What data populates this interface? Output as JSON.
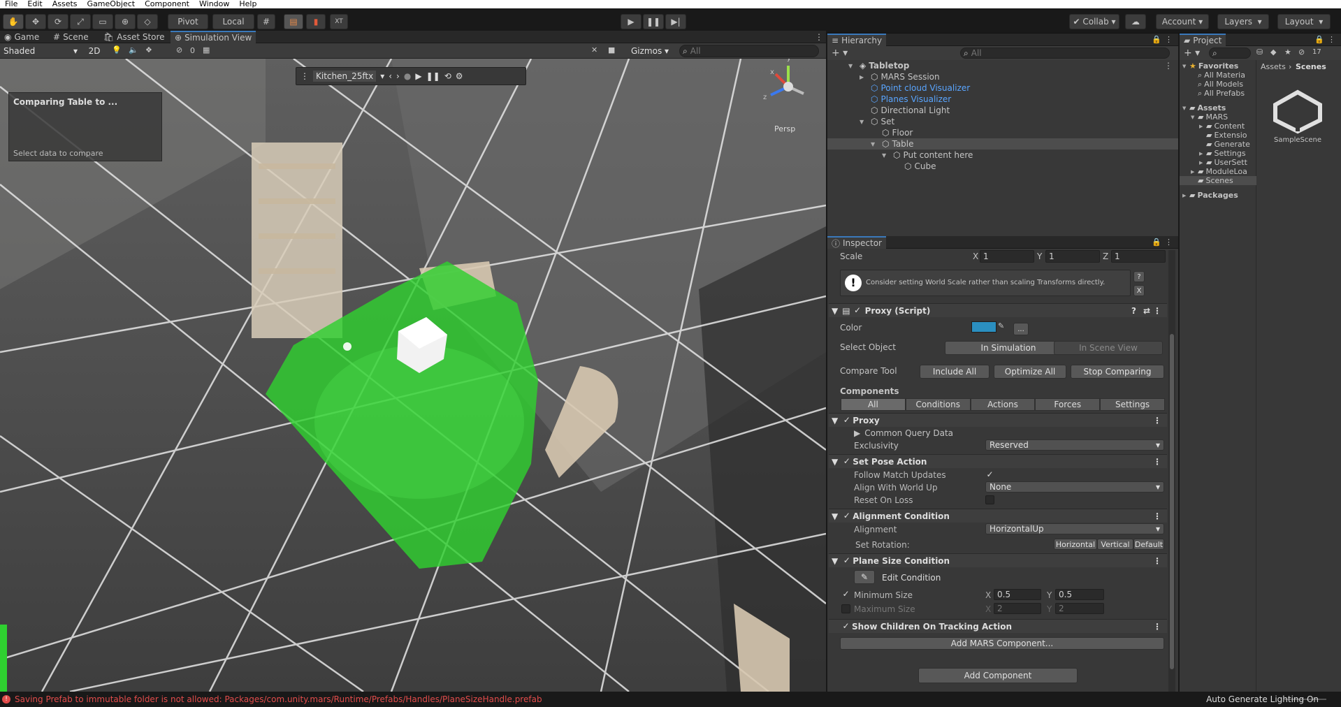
{
  "menu": [
    "File",
    "Edit",
    "Assets",
    "GameObject",
    "Component",
    "Window",
    "Help"
  ],
  "toolbar": {
    "pivot": "Pivot",
    "local": "Local",
    "collab": "Collab",
    "account": "Account",
    "layers": "Layers",
    "layout": "Layout"
  },
  "scene_tabs": {
    "game": "Game",
    "scene": "Scene",
    "store": "Asset Store",
    "sim": "Simulation View"
  },
  "scene_sub": {
    "shade": "Shaded",
    "twod": "2D",
    "hidden_count": "0",
    "gizmos": "Gizmos",
    "search_placeholder": "All"
  },
  "overlay": {
    "title": "Comparing Table to ...",
    "sub": "Select data to compare"
  },
  "simbar": {
    "env": "Kitchen_25ftx"
  },
  "gizmo": {
    "persp": "Persp",
    "x": "x",
    "y": "y",
    "z": "z"
  },
  "hierarchy": {
    "title": "Hierarchy",
    "search": "All",
    "items": [
      {
        "label": "Tabletop",
        "level": 0,
        "bold": true,
        "arrow": "▼"
      },
      {
        "label": "MARS Session",
        "level": 1,
        "arrow": "▶"
      },
      {
        "label": "Point cloud Visualizer",
        "level": 1,
        "blue": true
      },
      {
        "label": "Planes Visualizer",
        "level": 1,
        "blue": true
      },
      {
        "label": "Directional Light",
        "level": 1
      },
      {
        "label": "Set",
        "level": 1,
        "arrow": "▼"
      },
      {
        "label": "Floor",
        "level": 2
      },
      {
        "label": "Table",
        "level": 2,
        "arrow": "▼",
        "selected": true
      },
      {
        "label": "Put content here",
        "level": 3,
        "arrow": "▼"
      },
      {
        "label": "Cube",
        "level": 4
      }
    ]
  },
  "project": {
    "title": "Project",
    "breadcrumb_assets": "Assets",
    "breadcrumb_scenes": "Scenes",
    "layer_count": "17",
    "scene_name": "SampleScene",
    "tree": [
      {
        "label": "Favorites",
        "level": 0,
        "arrow": "▼",
        "bold": true
      },
      {
        "label": "All Materia",
        "level": 1
      },
      {
        "label": "All Models",
        "level": 1
      },
      {
        "label": "All Prefabs",
        "level": 1
      },
      {
        "label": "Assets",
        "level": 0,
        "arrow": "▼",
        "bold": true
      },
      {
        "label": "MARS",
        "level": 1,
        "arrow": "▼"
      },
      {
        "label": "Content",
        "level": 2,
        "arrow": "▶"
      },
      {
        "label": "Extensio",
        "level": 2
      },
      {
        "label": "Generate",
        "level": 2
      },
      {
        "label": "Settings",
        "level": 2,
        "arrow": "▶"
      },
      {
        "label": "UserSett",
        "level": 2,
        "arrow": "▶"
      },
      {
        "label": "ModuleLoa",
        "level": 1,
        "arrow": "▶"
      },
      {
        "label": "Scenes",
        "level": 1,
        "selected": true
      },
      {
        "label": "Packages",
        "level": 0,
        "arrow": "▶",
        "bold": true
      }
    ]
  },
  "inspector": {
    "title": "Inspector",
    "scale": {
      "label": "Scale",
      "x": "1",
      "y": "1",
      "z": "1",
      "xl": "X",
      "yl": "Y",
      "zl": "Z"
    },
    "warning": "Consider setting World Scale rather than scaling Transforms directly.",
    "warn_close": "X",
    "warn_help": "?",
    "proxy_title": "Proxy (Script)",
    "color_label": "Color",
    "color_more": "...",
    "select_object": "Select Object",
    "in_sim": "In Simulation",
    "in_scene": "In Scene View",
    "compare_tool": "Compare Tool",
    "include_all": "Include All",
    "optimize_all": "Optimize All",
    "stop_comparing": "Stop Comparing",
    "components": "Components",
    "comp_tabs": [
      "All",
      "Conditions",
      "Actions",
      "Forces",
      "Settings"
    ],
    "proxy": "Proxy",
    "common_query": "Common Query Data",
    "exclusivity": "Exclusivity",
    "exclusivity_val": "Reserved",
    "set_pose": "Set Pose Action",
    "follow": "Follow Match Updates",
    "align_world": "Align With World Up",
    "align_world_val": "None",
    "reset_loss": "Reset On Loss",
    "align_cond": "Alignment Condition",
    "alignment": "Alignment",
    "alignment_val": "HorizontalUp",
    "set_rotation": "Set Rotation:",
    "rot_h": "Horizontal",
    "rot_v": "Vertical",
    "rot_d": "Default",
    "plane_size": "Plane Size Condition",
    "edit_cond": "Edit Condition",
    "min_size": "Minimum Size",
    "min_x": "0.5",
    "min_y": "0.5",
    "max_size": "Maximum Size",
    "max_x": "2",
    "max_y": "2",
    "dim_x": "X",
    "dim_y": "Y",
    "show_children": "Show Children On Tracking Action",
    "add_mars": "Add MARS Component...",
    "add_component": "Add Component"
  },
  "status": {
    "error": "Saving Prefab to immutable folder is not allowed: Packages/com.unity.mars/Runtime/Prefabs/Handles/PlaneSizeHandle.prefab",
    "right": "Auto Generate Lighting On"
  },
  "colors": {
    "accent": "#3a79bb",
    "green": "#2fd030",
    "error": "#e24c4b",
    "link": "#59a5ff"
  }
}
